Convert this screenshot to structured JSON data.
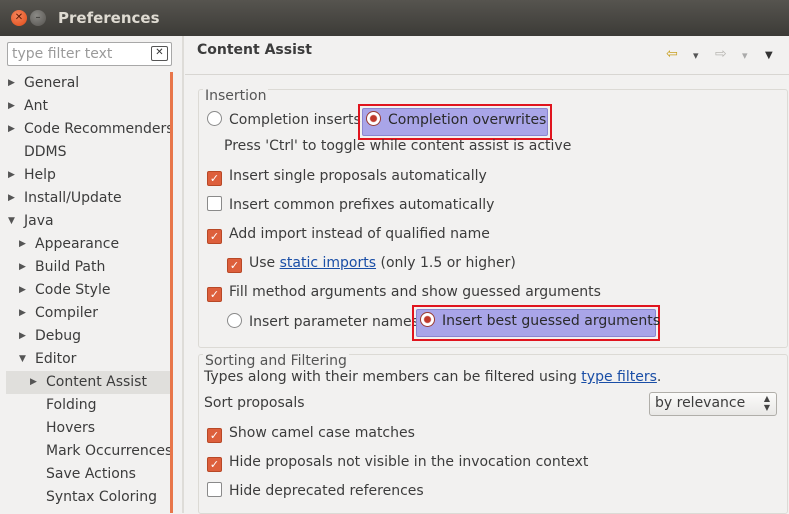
{
  "window": {
    "title": "Preferences"
  },
  "filter": {
    "placeholder": "type filter text"
  },
  "tree": [
    {
      "label": "General",
      "level": 0,
      "arrow": "▶"
    },
    {
      "label": "Ant",
      "level": 0,
      "arrow": "▶"
    },
    {
      "label": "Code Recommenders",
      "level": 0,
      "arrow": "▶"
    },
    {
      "label": "DDMS",
      "level": 0,
      "arrow": ""
    },
    {
      "label": "Help",
      "level": 0,
      "arrow": "▶"
    },
    {
      "label": "Install/Update",
      "level": 0,
      "arrow": "▶"
    },
    {
      "label": "Java",
      "level": 0,
      "arrow": "▼"
    },
    {
      "label": "Appearance",
      "level": 1,
      "arrow": "▶"
    },
    {
      "label": "Build Path",
      "level": 1,
      "arrow": "▶"
    },
    {
      "label": "Code Style",
      "level": 1,
      "arrow": "▶"
    },
    {
      "label": "Compiler",
      "level": 1,
      "arrow": "▶"
    },
    {
      "label": "Debug",
      "level": 1,
      "arrow": "▶"
    },
    {
      "label": "Editor",
      "level": 1,
      "arrow": "▼"
    },
    {
      "label": "Content Assist",
      "level": 2,
      "arrow": "▶",
      "selected": true
    },
    {
      "label": "Folding",
      "level": 2,
      "arrow": ""
    },
    {
      "label": "Hovers",
      "level": 2,
      "arrow": ""
    },
    {
      "label": "Mark Occurrences",
      "level": 2,
      "arrow": ""
    },
    {
      "label": "Save Actions",
      "level": 2,
      "arrow": ""
    },
    {
      "label": "Syntax Coloring",
      "level": 2,
      "arrow": ""
    }
  ],
  "page": {
    "title": "Content Assist",
    "nav": {
      "back": "⇦",
      "forward": "⇨",
      "dropdown": "▾",
      "menu": "▼"
    }
  },
  "insertion": {
    "legend": "Insertion",
    "completion_inserts": "Completion inserts",
    "completion_overwrites": "Completion overwrites",
    "toggle_hint": "Press 'Ctrl' to toggle while content assist is active",
    "insert_single": "Insert single proposals automatically",
    "insert_common": "Insert common prefixes automatically",
    "add_import": "Add import instead of qualified name",
    "use_prefix": "Use ",
    "use_link": "static imports",
    "use_suffix": " (only 1.5 or higher)",
    "fill_method": "Fill method arguments and show guessed arguments",
    "insert_param_names": "Insert parameter names",
    "insert_best": "Insert best guessed arguments"
  },
  "sorting": {
    "legend": "Sorting and Filtering",
    "desc_prefix": "Types along with their members can be filtered using ",
    "desc_link": "type filters",
    "desc_suffix": ".",
    "sort_label": "Sort proposals",
    "sort_value": "by relevance",
    "camel": "Show camel case matches",
    "hide_invisible": "Hide proposals not visible in the invocation context",
    "hide_deprecated": "Hide deprecated references"
  },
  "colors": {
    "accent": "#dd5f3c",
    "highlight_border": "#e0141e",
    "selection": "#a9a5e8",
    "link": "#1a4ea6"
  }
}
